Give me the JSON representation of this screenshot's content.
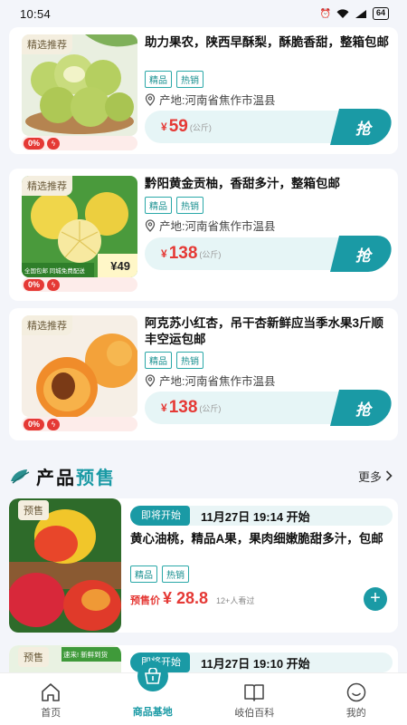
{
  "status_bar": {
    "time": "10:54",
    "battery": "64"
  },
  "products": [
    {
      "tag": "精选推荐",
      "title": "助力果农，陕西早酥梨，酥脆香甜，整箱包邮",
      "chips": [
        "精品",
        "热销"
      ],
      "origin": "产地:河南省焦作市温县",
      "price_symbol": "¥",
      "price": "59",
      "unit": "(公斤)",
      "buy_label": "抢",
      "discount": "0%",
      "image": "pears-image"
    },
    {
      "tag": "精选推荐",
      "title": "黔阳黄金贡柚，香甜多汁，整箱包邮",
      "chips": [
        "精品",
        "热销"
      ],
      "origin": "产地:河南省焦作市温县",
      "price_symbol": "¥",
      "price": "138",
      "unit": "(公斤)",
      "buy_label": "抢",
      "discount": "0%",
      "image": "pomelo-image",
      "img_banner": "全国包邮 同城免费配送",
      "img_price": "¥49"
    },
    {
      "tag": "精选推荐",
      "title": "阿克苏小红杏，吊干杏新鲜应当季水果3斤顺丰空运包邮",
      "chips": [
        "精品",
        "热销"
      ],
      "origin": "产地:河南省焦作市温县",
      "price_symbol": "¥",
      "price": "138",
      "unit": "(公斤)",
      "buy_label": "抢",
      "discount": "0%",
      "image": "apricot-image"
    }
  ],
  "presale_section": {
    "title_part1": "产品",
    "title_part2": "预售",
    "more": "更多",
    "items": [
      {
        "tag": "预售",
        "status": "即将开始",
        "time": "11月27日 19:14 开始",
        "title": "黄心油桃，精品A果，果肉细嫩脆甜多汁，包邮",
        "chips": [
          "精品",
          "热销"
        ],
        "price_label": "预售价",
        "price": "¥ 28.8",
        "watchers": "12+人看过",
        "image": "nectarine-image"
      },
      {
        "tag": "预售",
        "status": "即将开始",
        "time": "11月27日 19:10 开始",
        "image_text": "速来! 新鲜到货"
      }
    ]
  },
  "tab_bar": {
    "tabs": [
      {
        "label": "首页",
        "icon": "home-icon",
        "active": false
      },
      {
        "label": "商品基地",
        "icon": "store-icon",
        "active": true
      },
      {
        "label": "岐伯百科",
        "icon": "book-icon",
        "active": false
      },
      {
        "label": "我的",
        "icon": "smile-icon",
        "active": false
      }
    ]
  },
  "colors": {
    "accent": "#1a9aa5",
    "price": "#e53935",
    "chip": "#2aa8a8"
  }
}
